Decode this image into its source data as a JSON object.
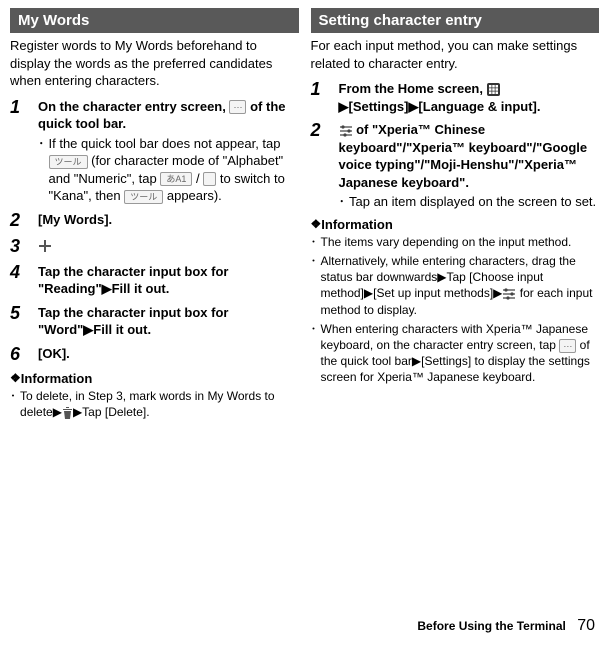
{
  "left": {
    "header": "My Words",
    "intro": "Register words to My Words beforehand to display the words as the preferred candidates when entering characters.",
    "steps": {
      "s1": {
        "num": "1",
        "title_a": "On the character entry screen, ",
        "title_b": " of the quick tool bar.",
        "sub_a": "If the quick tool bar does not appear, tap ",
        "sub_b": " (for character mode of \"Alphabet\" and \"Numeric\", tap ",
        "sub_c": " / ",
        "sub_d": " to switch to \"Kana\", then ",
        "sub_e": " appears)."
      },
      "s2": {
        "num": "2",
        "title": "[My Words]."
      },
      "s3": {
        "num": "3"
      },
      "s4": {
        "num": "4",
        "title": "Tap the character input box for \"Reading\"▶Fill it out."
      },
      "s5": {
        "num": "5",
        "title": "Tap the character input box for \"Word\"▶Fill it out."
      },
      "s6": {
        "num": "6",
        "title": "[OK]."
      }
    },
    "info_head": "Information",
    "info_1a": "To delete, in Step 3, mark words in My Words to delete▶",
    "info_1b": "▶Tap [Delete]."
  },
  "right": {
    "header": "Setting character entry",
    "intro": "For each input method, you can make settings related to character entry.",
    "steps": {
      "s1": {
        "num": "1",
        "title_a": "From the Home screen, ",
        "title_b": "▶[Settings]▶[Language & input]."
      },
      "s2": {
        "num": "2",
        "title_a": " of \"Xperia™ Chinese keyboard\"/\"Xperia™ keyboard\"/\"Google voice typing\"/\"Moji-Henshu\"/\"Xperia™ Japanese keyboard\".",
        "sub": "Tap an item displayed on the screen to set."
      }
    },
    "info_head": "Information",
    "info_1": "The items vary depending on the input method.",
    "info_2a": "Alternatively, while entering characters, drag the status bar downwards▶Tap [Choose input method]▶[Set up input methods]▶",
    "info_2b": " for each input method to display.",
    "info_3a": "When entering characters with Xperia™ Japanese keyboard, on the character entry screen, tap ",
    "info_3b": " of the quick tool bar▶[Settings] to display the settings screen for Xperia™ Japanese keyboard."
  },
  "footer": {
    "label": "Before Using the Terminal",
    "page": "70"
  },
  "icons": {
    "tool_label": "ツール",
    "kana_label": "あA1"
  }
}
